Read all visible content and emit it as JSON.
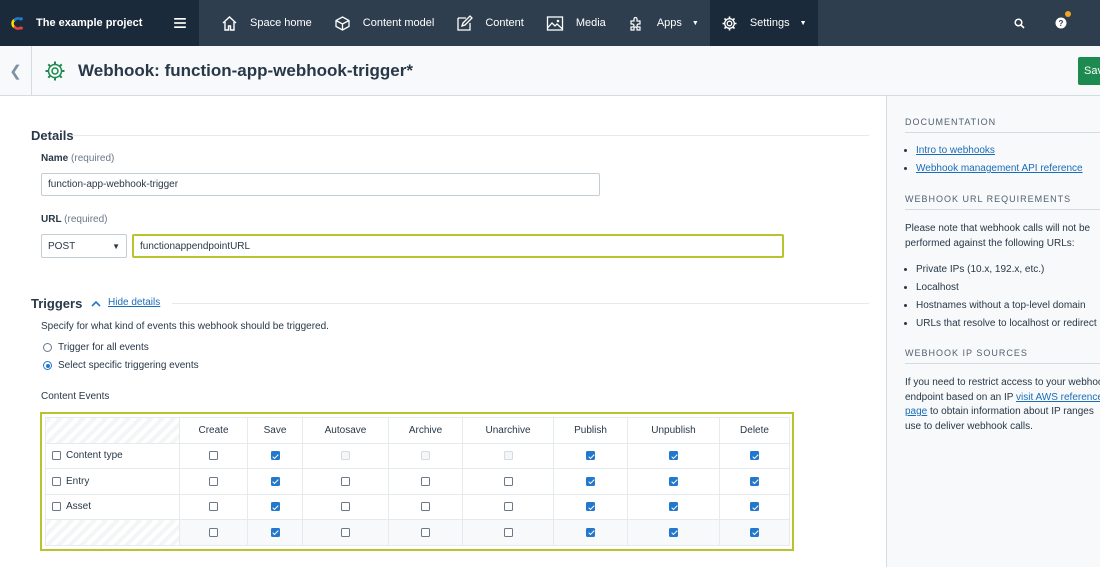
{
  "nav": {
    "project_name": "The example project",
    "items": [
      {
        "label": "Space home",
        "icon": "home-icon"
      },
      {
        "label": "Content model",
        "icon": "content-model-icon"
      },
      {
        "label": "Content",
        "icon": "content-icon"
      },
      {
        "label": "Media",
        "icon": "media-icon"
      },
      {
        "label": "Apps",
        "icon": "apps-icon"
      },
      {
        "label": "Settings",
        "icon": "gear-icon"
      }
    ]
  },
  "header": {
    "title": "Webhook: function-app-webhook-trigger*",
    "save_label": "Save"
  },
  "details": {
    "section_title": "Details",
    "name_label": "Name",
    "name_required": "(required)",
    "name_value": "function-app-webhook-trigger",
    "url_label": "URL",
    "url_required": "(required)",
    "method": "POST",
    "url_value": "functionappendpointURL"
  },
  "triggers": {
    "section_title": "Triggers",
    "toggle_label": "Hide details",
    "description": "Specify for what kind of events this webhook should be triggered.",
    "radio_all": "Trigger for all events",
    "radio_specific": "Select specific triggering events",
    "content_events_label": "Content Events",
    "columns": [
      "Create",
      "Save",
      "Autosave",
      "Archive",
      "Unarchive",
      "Publish",
      "Unpublish",
      "Delete"
    ],
    "rows": [
      {
        "label": "Content type",
        "checks": [
          false,
          true,
          null,
          null,
          null,
          true,
          true,
          true
        ]
      },
      {
        "label": "Entry",
        "checks": [
          false,
          true,
          false,
          false,
          false,
          true,
          true,
          true
        ]
      },
      {
        "label": "Asset",
        "checks": [
          false,
          true,
          false,
          false,
          false,
          true,
          true,
          true
        ]
      },
      {
        "label": "",
        "checks": [
          false,
          true,
          false,
          false,
          false,
          true,
          true,
          true
        ]
      }
    ]
  },
  "sidebar": {
    "doc_heading": "DOCUMENTATION",
    "doc_links": [
      "Intro to webhooks",
      "Webhook management API reference"
    ],
    "url_req_heading": "WEBHOOK URL REQUIREMENTS",
    "url_req_text_1": "Please note that webhook calls will not be",
    "url_req_text_2": "performed against the following URLs:",
    "url_req_items": [
      "Private IPs (10.x, 192.x, etc.)",
      "Localhost",
      "Hostnames without a top-level domain",
      "URLs that resolve to localhost or redirect"
    ],
    "ip_heading": "WEBHOOK IP SOURCES",
    "ip_text_1": "If you need to restrict access to your webhook",
    "ip_text_2a": "endpoint based on an IP ",
    "ip_link": "visit AWS reference",
    "ip_link_2": "page",
    "ip_text_3": " to obtain information about IP ranges",
    "ip_text_4": "use to deliver webhook calls."
  }
}
